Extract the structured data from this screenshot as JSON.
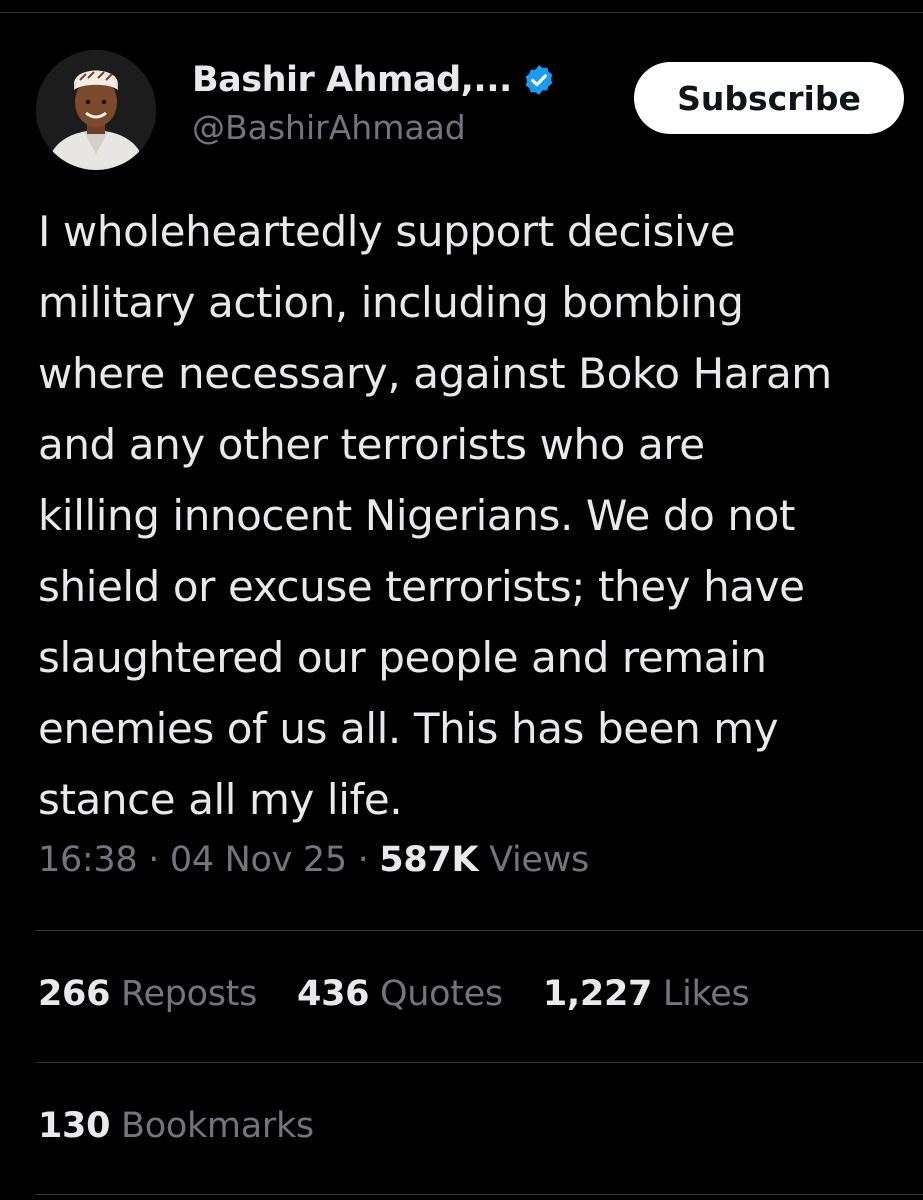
{
  "author": {
    "display_name": "Bashir Ahmad,...",
    "handle": "@BashirAhmaad",
    "verified_color": "#1d9bf0"
  },
  "subscribe_label": "Subscribe",
  "tweet": {
    "lines": [
      "I wholeheartedly support decisive",
      "military action, including bombing",
      "where necessary, against Boko Haram",
      "and any other terrorists who are",
      "killing innocent Nigerians. We do not",
      "shield or excuse terrorists; they have",
      "slaughtered our people and remain",
      "enemies of us all. This has been my",
      "stance all my life."
    ]
  },
  "meta": {
    "time": "16:38",
    "separator": "·",
    "date": "04 Nov 25",
    "views_count": "587K",
    "views_label": "Views"
  },
  "stats": {
    "reposts": {
      "count": "266",
      "label": "Reposts"
    },
    "quotes": {
      "count": "436",
      "label": "Quotes"
    },
    "likes": {
      "count": "1,227",
      "label": "Likes"
    },
    "bookmarks": {
      "count": "130",
      "label": "Bookmarks"
    }
  },
  "icons": {
    "verified": "verified-badge-icon",
    "avatar": "profile-photo"
  },
  "colors": {
    "background": "#000000",
    "text": "#e7e9ea",
    "secondary_text": "#71767b",
    "divider": "#2f3336",
    "button_bg": "#ffffff",
    "button_text": "#0f1419"
  }
}
